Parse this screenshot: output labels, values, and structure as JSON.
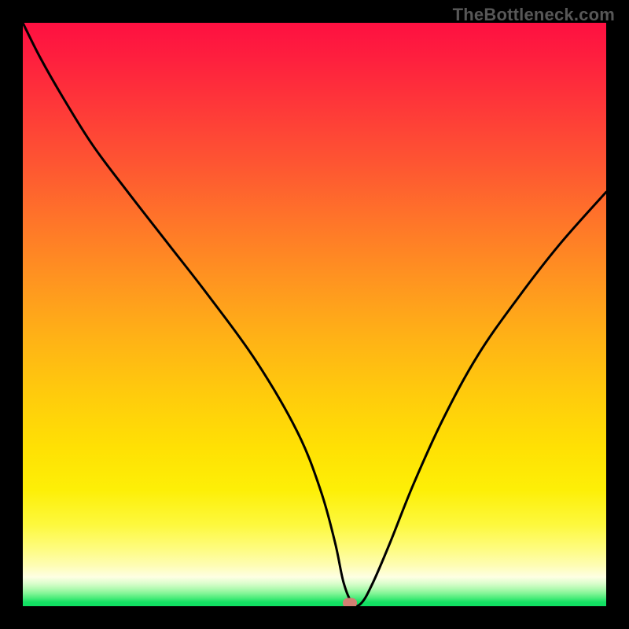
{
  "watermark": "TheBottleneck.com",
  "chart_data": {
    "type": "line",
    "title": "",
    "xlabel": "",
    "ylabel": "",
    "xlim": [
      0,
      100
    ],
    "ylim": [
      0,
      100
    ],
    "grid": false,
    "legend": false,
    "background": {
      "type": "vertical-gradient",
      "stops": [
        {
          "pos": 0,
          "color": "#fe1041"
        },
        {
          "pos": 95,
          "color": "#feffe3"
        },
        {
          "pos": 100,
          "color": "#0fdf62"
        }
      ],
      "semantics": "bottleneck severity (top=red=bad, bottom=green=good)"
    },
    "series": [
      {
        "name": "bottleneck-curve",
        "color": "#000000",
        "x": [
          0,
          3,
          7,
          12,
          18,
          25,
          32,
          40,
          47,
          51,
          53.5,
          55,
          56.5,
          58,
          60,
          63,
          67,
          72,
          78,
          85,
          92,
          100
        ],
        "y": [
          100,
          94,
          87,
          79,
          71,
          62,
          53,
          42,
          30,
          20,
          11,
          4,
          0.5,
          0.5,
          4,
          11,
          21,
          32,
          43,
          53,
          62,
          71
        ]
      }
    ],
    "marker": {
      "name": "optimal-point",
      "x": 56,
      "y": 0.5,
      "color": "#d27f73",
      "shape": "rounded-rect"
    },
    "frame": {
      "inner_size_px": 742,
      "border_color": "#000000",
      "border_width_px": 29
    }
  }
}
